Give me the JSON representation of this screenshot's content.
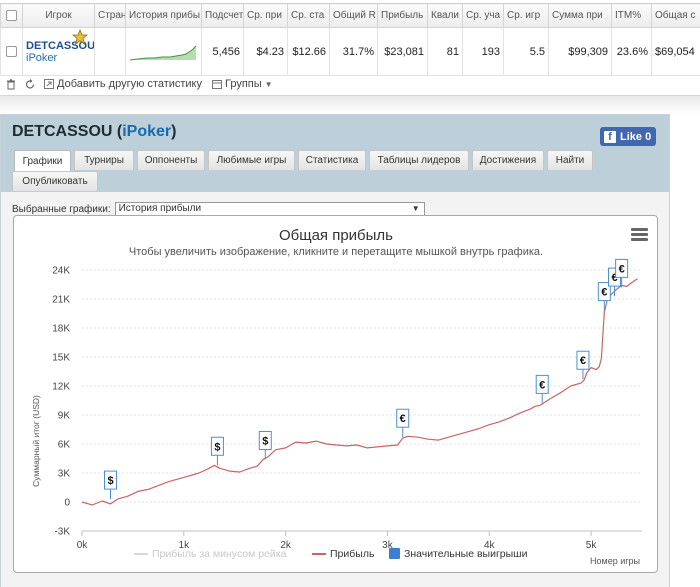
{
  "table": {
    "headers": [
      "",
      "Игрок",
      "Стран",
      "История прибы",
      "Подсчет",
      "Ср. при",
      "Ср. ста",
      "Общий R",
      "Прибыль",
      "Квали",
      "Ср. уча",
      "Ср. игр",
      "Сумма при",
      "ITM%",
      "Общая с"
    ],
    "row": {
      "player": "DETCASSOU",
      "network": "iPoker",
      "count": "5,456",
      "avg_profit": "$4.23",
      "avg_stake": "$12.66",
      "total_roi": "31.7%",
      "profit": "$23,081",
      "qual": "81",
      "avg_entrants": "193",
      "avg_game": "5.5",
      "prize_sum": "$99,309",
      "itm": "23.6%",
      "total_stake": "$69,054"
    }
  },
  "toolbar": {
    "add_stats": "Добавить другую статистику",
    "groups": "Группы"
  },
  "panel": {
    "player": "DETCASSOU",
    "open_paren": " (",
    "network": "iPoker",
    "close_paren": ")",
    "like": "Like 0",
    "fb_letter": "f",
    "tabs": [
      "Графики",
      "Турниры",
      "Оппоненты",
      "Любимые игры",
      "Статистика",
      "Таблицы лидеров",
      "Достижения",
      "Найти",
      "Опубликовать"
    ],
    "selected_label": "Выбранные графики:",
    "selected_value": "История прибыли"
  },
  "chart_data": {
    "type": "line",
    "title": "Общая прибыль",
    "subtitle": "Чтобы увеличить изображение, кликните и перетащите мышкой внутрь графика.",
    "ylabel": "Суммарный итог (USD)",
    "xlabel": "Номер игры",
    "ylim": [
      -3000,
      24000
    ],
    "xlim": [
      0,
      5500
    ],
    "yticks": [
      "-3K",
      "0",
      "3K",
      "6K",
      "9K",
      "12K",
      "15K",
      "18K",
      "21K",
      "24K"
    ],
    "xticks": [
      "0k",
      "1k",
      "2k",
      "3k",
      "4k",
      "5k"
    ],
    "grid": "horizontal",
    "legend": [
      "Прибыль за минусом рейка",
      "Прибыль",
      "Значительные выигрыши"
    ],
    "series": [
      {
        "name": "Прибыль",
        "color": "#c96464",
        "x": [
          0,
          100,
          200,
          280,
          350,
          450,
          550,
          650,
          750,
          850,
          950,
          1050,
          1150,
          1250,
          1300,
          1350,
          1450,
          1550,
          1650,
          1720,
          1780,
          1830,
          1900,
          2000,
          2100,
          2200,
          2300,
          2400,
          2500,
          2600,
          2700,
          2800,
          2900,
          3000,
          3100,
          3150,
          3200,
          3300,
          3400,
          3500,
          3600,
          3700,
          3800,
          3900,
          4000,
          4100,
          4200,
          4300,
          4400,
          4450,
          4500,
          4600,
          4700,
          4800,
          4900,
          4930,
          4960,
          5000,
          5050,
          5080,
          5100,
          5130,
          5160,
          5200,
          5250,
          5300,
          5350,
          5400,
          5456
        ],
        "values": [
          0,
          -300,
          100,
          -200,
          300,
          600,
          1100,
          1300,
          1700,
          2100,
          2400,
          2700,
          3000,
          3500,
          3800,
          3500,
          3200,
          3100,
          3500,
          3700,
          4400,
          4700,
          5400,
          5600,
          6200,
          6100,
          6300,
          6000,
          5900,
          5800,
          5900,
          5600,
          5700,
          5800,
          5900,
          6600,
          6800,
          6700,
          6500,
          6400,
          6700,
          7000,
          7300,
          7600,
          8000,
          8300,
          8700,
          9200,
          9600,
          9900,
          10000,
          10700,
          11300,
          12000,
          12300,
          12600,
          13400,
          13900,
          13700,
          14000,
          14800,
          19600,
          21000,
          21500,
          22000,
          22400,
          22300,
          22700,
          23100
        ]
      }
    ],
    "big_wins": [
      {
        "x": 280,
        "y": 300,
        "symbol": "$"
      },
      {
        "x": 1330,
        "y": 3800,
        "symbol": "$"
      },
      {
        "x": 1800,
        "y": 4400,
        "symbol": "$"
      },
      {
        "x": 3150,
        "y": 6700,
        "symbol": "€"
      },
      {
        "x": 4520,
        "y": 10200,
        "symbol": "€"
      },
      {
        "x": 4920,
        "y": 12700,
        "symbol": "€"
      },
      {
        "x": 5130,
        "y": 19800,
        "symbol": "€"
      },
      {
        "x": 5230,
        "y": 21300,
        "symbol": "€"
      },
      {
        "x": 5300,
        "y": 22200,
        "symbol": "€"
      }
    ]
  }
}
